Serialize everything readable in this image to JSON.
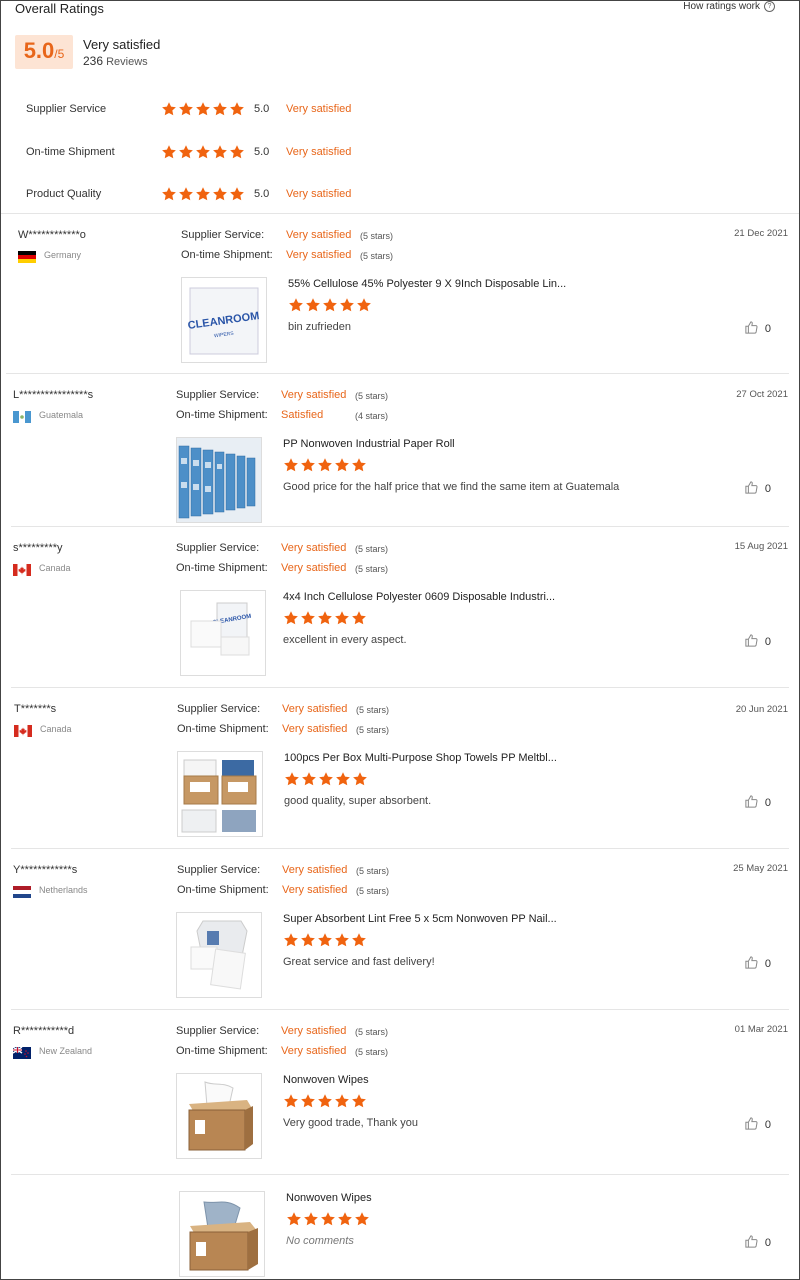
{
  "overall": {
    "title": "Overall Ratings",
    "how_link": "How ratings work",
    "score": "5.0",
    "score_max": "/5",
    "summary": "Very satisfied",
    "review_count": "236",
    "reviews_label": "Reviews"
  },
  "ratings": [
    {
      "label": "Supplier Service",
      "value": "5.0",
      "text": "Very satisfied",
      "stars": 5
    },
    {
      "label": "On-time Shipment",
      "value": "5.0",
      "text": "Very satisfied",
      "stars": 5
    },
    {
      "label": "Product Quality",
      "value": "5.0",
      "text": "Very satisfied",
      "stars": 5
    }
  ],
  "labels": {
    "supplier_service": "Supplier Service:",
    "ontime_shipment": "On-time Shipment:"
  },
  "reviews": [
    {
      "name": "W************o",
      "country": "Germany",
      "flag": "de",
      "date": "21 Dec 2021",
      "service": "Very satisfied",
      "service_count": "(5 stars)",
      "shipment": "Very satisfied",
      "shipment_count": "(5 stars)",
      "product": "55% Cellulose 45% Polyester 9 X 9Inch Disposable Lin...",
      "comment": "bin zufrieden",
      "likes": "0",
      "img": "cleanroom"
    },
    {
      "name": "L****************s",
      "country": "Guatemala",
      "flag": "gt",
      "date": "27 Oct 2021",
      "service": "Very satisfied",
      "service_count": "(5 stars)",
      "shipment": "Satisfied",
      "shipment_count": "(4 stars)",
      "product": "PP Nonwoven Industrial Paper Roll",
      "comment": "Good price for the half price that we find the same item at Guatemala",
      "likes": "0",
      "img": "rolls"
    },
    {
      "name": "s*********y",
      "country": "Canada",
      "flag": "ca",
      "date": "15 Aug 2021",
      "service": "Very satisfied",
      "service_count": "(5 stars)",
      "shipment": "Very satisfied",
      "shipment_count": "(5 stars)",
      "product": "4x4 Inch Cellulose Polyester 0609 Disposable Industri...",
      "comment": "excellent in every aspect.",
      "likes": "0",
      "img": "wipes"
    },
    {
      "name": "T*******s",
      "country": "Canada",
      "flag": "ca",
      "date": "20 Jun 2021",
      "service": "Very satisfied",
      "service_count": "(5 stars)",
      "shipment": "Very satisfied",
      "shipment_count": "(5 stars)",
      "product": "100pcs Per Box Multi-Purpose Shop Towels PP Meltbl...",
      "comment": "good quality, super absorbent.",
      "likes": "0",
      "img": "boxes"
    },
    {
      "name": "Y************s",
      "country": "Netherlands",
      "flag": "nl",
      "date": "25 May 2021",
      "service": "Very satisfied",
      "service_count": "(5 stars)",
      "shipment": "Very satisfied",
      "shipment_count": "(5 stars)",
      "product": "Super Absorbent Lint Free 5 x 5cm Nonwoven PP Nail...",
      "comment": "Great service and fast delivery!",
      "likes": "0",
      "img": "pads"
    },
    {
      "name": "R***********d",
      "country": "New Zealand",
      "flag": "nz",
      "date": "01 Mar 2021",
      "service": "Very satisfied",
      "service_count": "(5 stars)",
      "shipment": "Very satisfied",
      "shipment_count": "(5 stars)",
      "product": "Nonwoven Wipes",
      "comment": "Very good trade, Thank you",
      "likes": "0",
      "img": "popup"
    }
  ],
  "extra_item": {
    "product": "Nonwoven Wipes",
    "comment": "No comments",
    "likes": "0",
    "img": "popup2"
  },
  "colors": {
    "accent": "#e8661a",
    "star": "#f0630f",
    "score_bg": "#fde4d4"
  }
}
